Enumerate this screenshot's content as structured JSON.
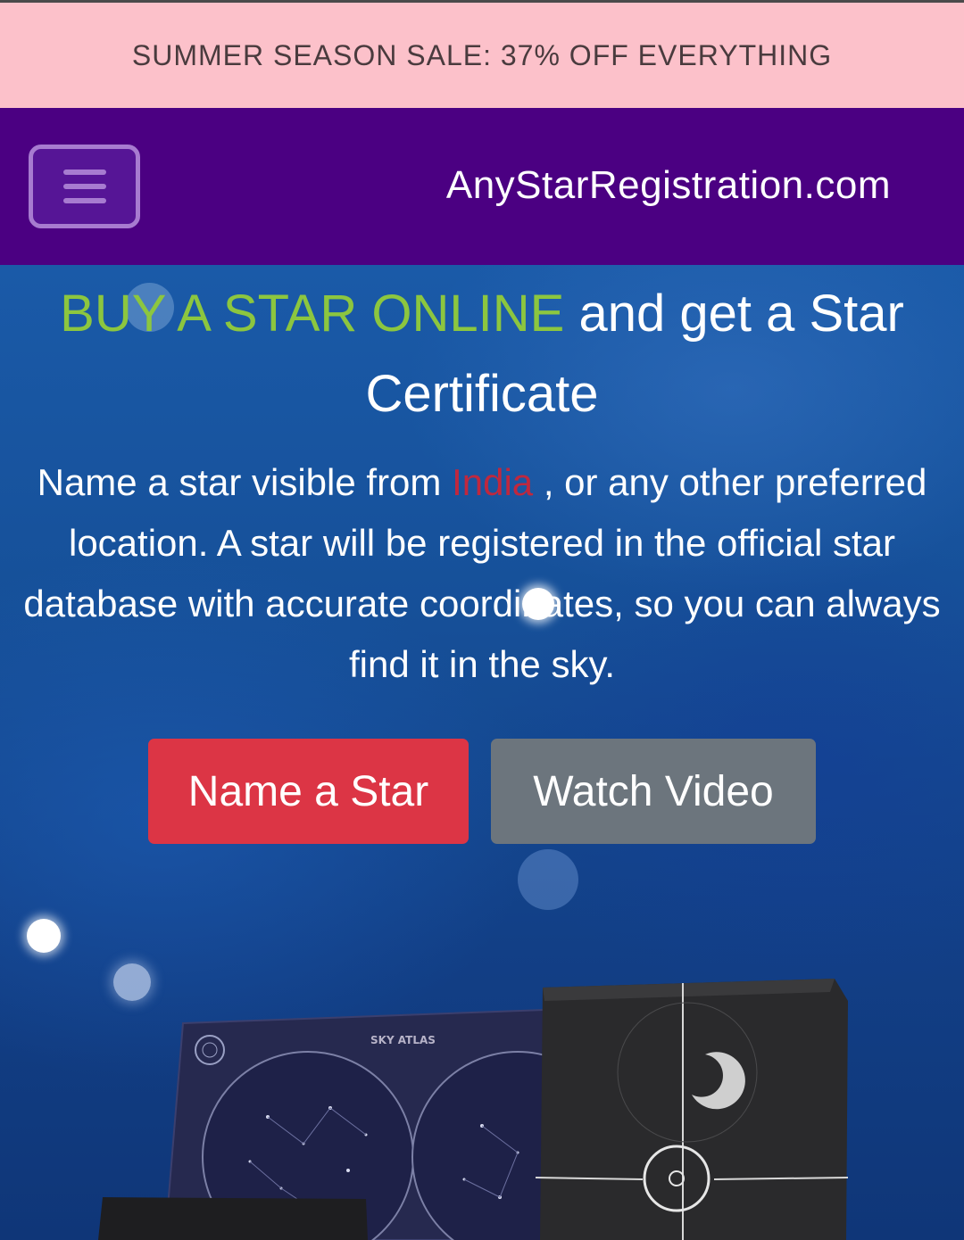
{
  "promo": {
    "text": "SUMMER SEASON SALE: 37% OFF EVERYTHING"
  },
  "header": {
    "menu_icon": "hamburger-menu-icon",
    "brand": "AnyStarRegistration.com"
  },
  "hero": {
    "title_highlight": "BUY A STAR ONLINE",
    "title_rest": " and get a Star Certificate",
    "description_before": "Name a star visible from ",
    "description_location": "India",
    "description_after": " , or any other preferred location. A star will be registered in the official star database with accurate coordinates, so you can always find it in the sky.",
    "primary_button": "Name a Star",
    "secondary_button": "Watch Video",
    "product_image_text": "SKY ATLAS"
  },
  "colors": {
    "promo_bg": "#fcc1ca",
    "nav_bg": "#4b0082",
    "title_accent": "#8cc63f",
    "location_text": "#c0283e",
    "primary_button": "#dc3545",
    "secondary_button": "#6c757d"
  }
}
